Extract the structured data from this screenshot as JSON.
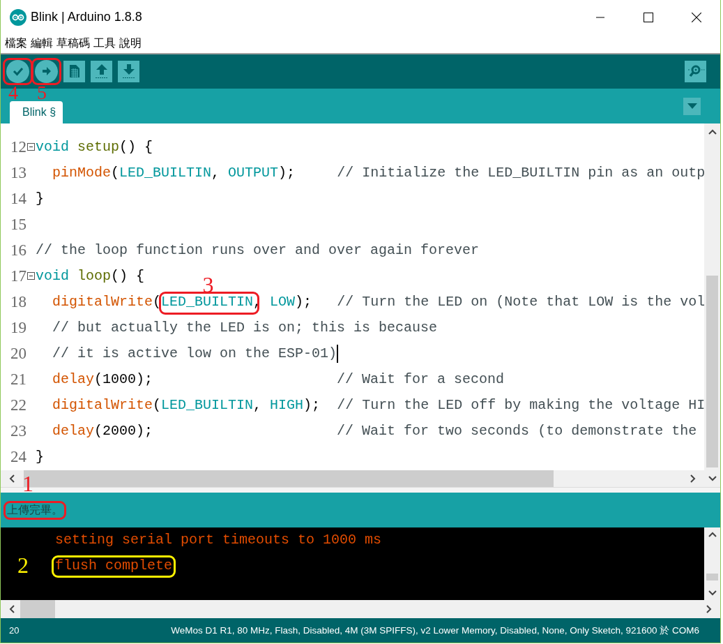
{
  "window": {
    "title": "Blink | Arduino 1.8.8"
  },
  "menu": [
    "檔案",
    "編輯",
    "草稿碼",
    "工具",
    "說明"
  ],
  "toolbar": [
    {
      "kind": "verify",
      "annotation": {
        "label": "4",
        "color": "#ed1c24"
      }
    },
    {
      "kind": "upload",
      "annotation": {
        "label": "5",
        "color": "#ed1c24"
      }
    },
    {
      "kind": "new"
    },
    {
      "kind": "open"
    },
    {
      "kind": "save"
    },
    {
      "kind": "serial"
    }
  ],
  "tabs": [
    {
      "label": "Blink §",
      "selected": true
    }
  ],
  "editor": {
    "lines": [
      {
        "number": "12",
        "foldable": true,
        "tokens": [
          {
            "text": "void ",
            "kind": "kw"
          },
          {
            "text": "setup",
            "kind": "struct"
          },
          {
            "text": "() {"
          }
        ]
      },
      {
        "number": "13",
        "tokens": [
          {
            "text": "  pinMode",
            "kind": "fn"
          },
          {
            "text": "("
          },
          {
            "text": "LED_BUILTIN",
            "kind": "kw"
          },
          {
            "text": ", "
          },
          {
            "text": "OUTPUT",
            "kind": "kw"
          },
          {
            "text": ");     "
          },
          {
            "text": "// Initialize the LED_BUILTIN pin as an outp",
            "kind": "cm"
          }
        ]
      },
      {
        "number": "14",
        "tokens": [
          {
            "text": "}"
          }
        ]
      },
      {
        "number": "15"
      },
      {
        "number": "16",
        "tokens": [
          {
            "text": "// the loop function runs over and over again forever",
            "kind": "cm"
          }
        ]
      },
      {
        "number": "17",
        "foldable": true,
        "tokens": [
          {
            "text": "void ",
            "kind": "kw"
          },
          {
            "text": "loop",
            "kind": "struct"
          },
          {
            "text": "() {"
          }
        ]
      },
      {
        "number": "18",
        "annotation": {
          "label": "3",
          "color": "#ed1c24"
        },
        "tokens": [
          {
            "text": "  digitalWrite",
            "kind": "fn"
          },
          {
            "text": "("
          },
          {
            "text": "LED_BUILTIN",
            "kind": "kw",
            "annotated": true
          },
          {
            "text": ", "
          },
          {
            "text": "LOW",
            "kind": "kw"
          },
          {
            "text": ");   "
          },
          {
            "text": "// Turn the LED on (Note that LOW is the vol",
            "kind": "cm"
          }
        ]
      },
      {
        "number": "19",
        "tokens": [
          {
            "text": "  // but actually the LED is on; this is because",
            "kind": "cm"
          }
        ]
      },
      {
        "number": "20",
        "cursor": true,
        "tokens": [
          {
            "text": "  // it is active low on the ESP-01)",
            "kind": "cm"
          }
        ]
      },
      {
        "number": "21",
        "tokens": [
          {
            "text": "  delay",
            "kind": "fn"
          },
          {
            "text": "(1000);                      "
          },
          {
            "text": "// Wait for a second",
            "kind": "cm"
          }
        ]
      },
      {
        "number": "22",
        "tokens": [
          {
            "text": "  digitalWrite",
            "kind": "fn"
          },
          {
            "text": "("
          },
          {
            "text": "LED_BUILTIN",
            "kind": "kw"
          },
          {
            "text": ", "
          },
          {
            "text": "HIGH",
            "kind": "kw"
          },
          {
            "text": ");  "
          },
          {
            "text": "// Turn the LED off by making the voltage HI",
            "kind": "cm"
          }
        ]
      },
      {
        "number": "23",
        "tokens": [
          {
            "text": "  delay",
            "kind": "fn"
          },
          {
            "text": "(2000);                      "
          },
          {
            "text": "// Wait for two seconds (to demonstrate the",
            "kind": "cm"
          }
        ]
      },
      {
        "number": "24",
        "tokens": [
          {
            "text": "}"
          }
        ]
      }
    ]
  },
  "status": {
    "message": "上傳完畢。",
    "annotation": {
      "label": "1",
      "color": "#ed1c24"
    }
  },
  "console": {
    "lines": [
      {
        "text": "setting serial port timeouts to 1000 ms"
      },
      {
        "text": "flush complete",
        "annotation": {
          "label": "2",
          "color": "#fff200"
        }
      }
    ]
  },
  "footer": {
    "line": "20",
    "board": "WeMos D1 R1, 80 MHz, Flash, Disabled, 4M (3M SPIFFS), v2 Lower Memory, Disabled, None, Only Sketch, 921600 於 COM6"
  }
}
